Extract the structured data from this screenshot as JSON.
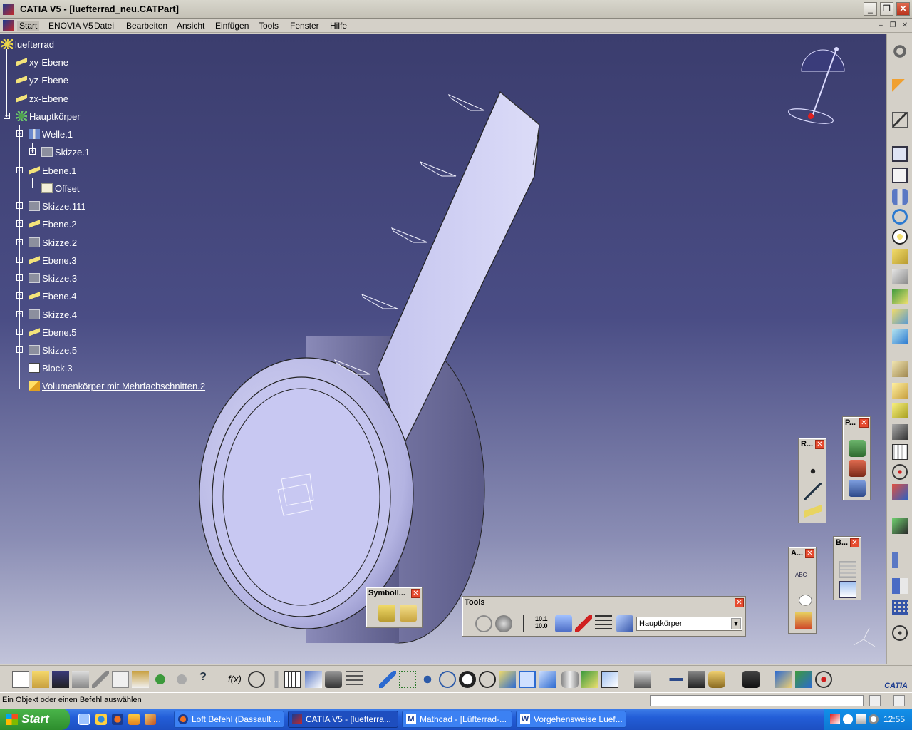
{
  "window": {
    "title": "CATIA V5 - [luefterrad_neu.CATPart]",
    "minimize": "_",
    "maximize": "❐",
    "close": "✕"
  },
  "menu": {
    "items": [
      "Start",
      "ENOVIA V5",
      "Datei",
      "Bearbeiten",
      "Ansicht",
      "Einfügen",
      "Tools",
      "Fenster",
      "Hilfe"
    ]
  },
  "tree": {
    "root": "luefterrad",
    "planes": [
      "xy-Ebene",
      "yz-Ebene",
      "zx-Ebene"
    ],
    "body": "Hauptkörper",
    "welle": "Welle.1",
    "skizze1": "Skizze.1",
    "ebene1": "Ebene.1",
    "offset": "Offset",
    "skizze111": "Skizze.111",
    "ebene2": "Ebene.2",
    "skizze2": "Skizze.2",
    "ebene3": "Ebene.3",
    "skizze3": "Skizze.3",
    "ebene4": "Ebene.4",
    "skizze4": "Skizze.4",
    "ebene5": "Ebene.5",
    "skizze5": "Skizze.5",
    "block": "Block.3",
    "multi": "Volumenkörper mit Mehrfachschnitten.2"
  },
  "panels": {
    "symbol": "Symboll...",
    "tools": "Tools",
    "tools_combo": "Hauptkörper",
    "r": "R...",
    "p": "P...",
    "a": "A...",
    "b": "B..."
  },
  "status": {
    "message": "Ein Objekt oder einen Befehl auswählen"
  },
  "taskbar": {
    "start": "Start",
    "tasks": [
      "Loft Befehl (Dassault ...",
      "CATIA V5 - [luefterra...",
      "Mathcad - [Lüfterrad-...",
      "Vorgehensweise Luef..."
    ],
    "clock": "12:55"
  },
  "colors": {
    "viewport_top": "#3b3d6e",
    "part_fill": "#c8c8f0",
    "taskbar": "#235ed8"
  }
}
